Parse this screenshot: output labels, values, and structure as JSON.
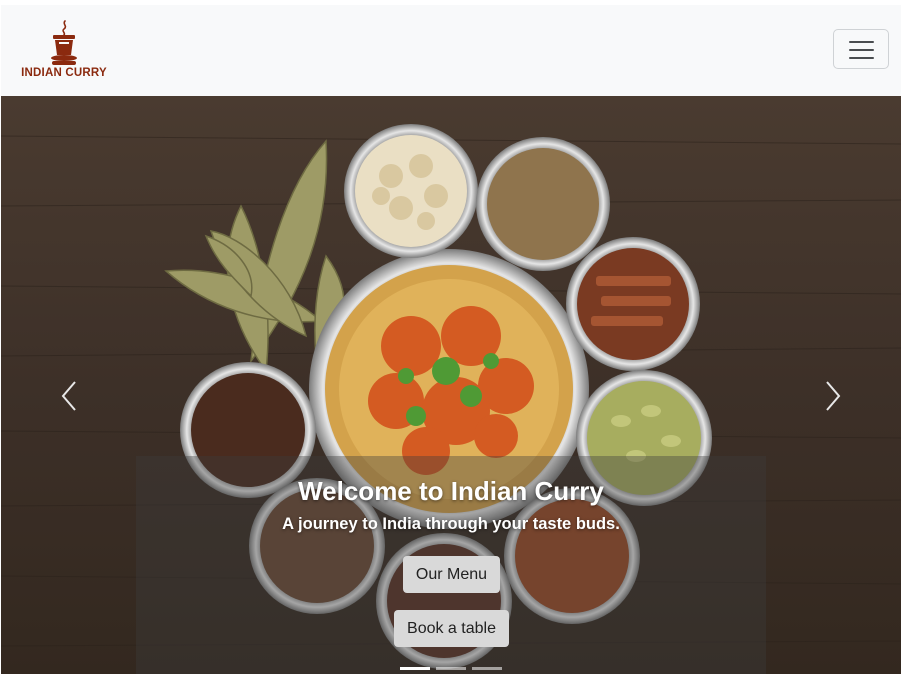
{
  "navbar": {
    "brand_text": "INDIAN CURRY",
    "brand_icon": "coffee-cup-logo-icon",
    "toggler_icon": "hamburger-menu-icon",
    "brand_color": "#8b2a0f"
  },
  "carousel": {
    "slide_image": "spices-and-biryani-photo",
    "prev_icon": "chevron-left-icon",
    "next_icon": "chevron-right-icon",
    "caption": {
      "title": "Welcome to Indian Curry",
      "subtitle": "A journey to India through your taste buds.",
      "menu_button": "Our Menu",
      "book_button": "Book a table"
    },
    "indicators": [
      {
        "active": true
      },
      {
        "active": false
      },
      {
        "active": false
      }
    ]
  }
}
